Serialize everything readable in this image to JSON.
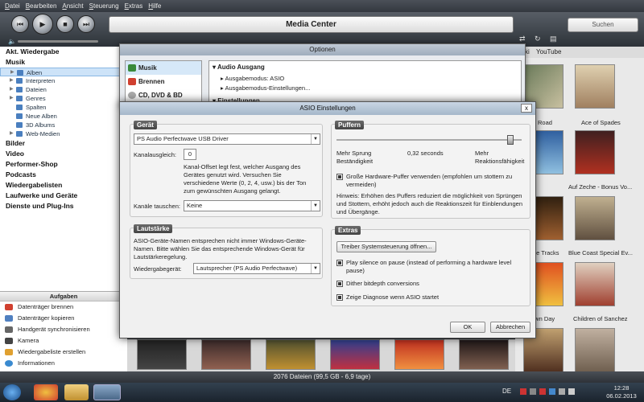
{
  "menu": [
    "Datei",
    "Bearbeiten",
    "Ansicht",
    "Steuerung",
    "Extras",
    "Hilfe"
  ],
  "app_title": "Media Center",
  "search_placeholder": "Suchen",
  "nav": {
    "now_playing": "Akt. Wiedergabe",
    "music": "Musik",
    "music_items": [
      "Alben",
      "Interpreten",
      "Dateien",
      "Genres",
      "Spalten",
      "Neue Alben",
      "3D Albums",
      "Web-Medien"
    ],
    "sections": [
      "Bilder",
      "Video",
      "Performer-Shop",
      "Podcasts",
      "Wiedergabelisten",
      "Laufwerke und Geräte",
      "Dienste und Plug-Ins"
    ]
  },
  "tasks": {
    "header": "Aufgaben",
    "items": [
      "Datenträger brennen",
      "Datenträger kopieren",
      "Handgerät synchronisieren",
      "Kamera",
      "Wiedergabeliste erstellen",
      "Informationen"
    ]
  },
  "right_tabs": {
    "left": "ki",
    "youtube": "YouTube"
  },
  "covers": [
    {
      "label": "Road"
    },
    {
      "label": "Ace of Spades"
    },
    {
      "label": "Auf Zeche - Bonus Vo..."
    },
    {
      "label": "ne Tracks"
    },
    {
      "label": "Blue Coast Special Ev..."
    },
    {
      "label": "own Day"
    },
    {
      "label": "Children of Sanchez"
    }
  ],
  "status": "2076 Dateien (99,5 GB - 6,9 tage)",
  "tray": {
    "lang": "DE",
    "time": "12:28",
    "date": "06.02.2013"
  },
  "optionen": {
    "title": "Optionen",
    "left_items": [
      "Musik",
      "Brennen",
      "CD, DVD & BD"
    ],
    "section": "Audio Ausgang",
    "rows": [
      "Ausgabemodus: ASIO",
      "Ausgabemodus-Einstellungen..."
    ],
    "section2": "Einstellungen"
  },
  "asio": {
    "title": "ASIO Einstellungen",
    "close": "x",
    "geraet": {
      "title": "Gerät",
      "device": "PS Audio Perfectwave USB Driver",
      "offset_label": "Kanalausgleich:",
      "offset_value": "0",
      "offset_help": "Kanal-Offset legt fest, welcher Ausgang des Gerätes genutzt wird. Versuchen Sie verschiedene Werte (0, 2, 4, usw.) bis der Ton zum gewünschten Ausgang gelangt.",
      "swap_label": "Kanäle tauschen:",
      "swap_value": "Keine"
    },
    "lautstaerke": {
      "title": "Lautstärke",
      "help": "ASIO-Geräte-Namen entsprechen nicht immer Windows-Geräte-Namen. Bitte wählen Sie das entsprechende Windows-Gerät für Lautstärkeregelung.",
      "device_label": "Wiedergabegerät:",
      "device_value": "Lautsprecher (PS Audio Perfectwave)"
    },
    "puffern": {
      "title": "Puffern",
      "left": "Mehr Sprung Beständigkeit",
      "value": "0,32 seconds",
      "right": "Mehr Reaktionsfähigkeit",
      "big_buffer": "Große Hardware-Puffer verwenden (empfohlen um stottern zu vermeiden)",
      "hint": "Hinweis: Erhöhen des Puffers reduziert die möglichkeit von Sprüngen und Stottern, erhöht jedoch auch die Reaktionszeit für Einblendungen und Übergänge."
    },
    "extras": {
      "title": "Extras",
      "button": "Treiber Systemsteuerung öffnen...",
      "opt1": "Play silence on pause (instead of performing a hardware level pause)",
      "opt2": "Dither bitdepth conversions",
      "opt3": "Zeige Diagnose wenn ASIO startet"
    },
    "ok": "OK",
    "cancel": "Abbrechen"
  }
}
